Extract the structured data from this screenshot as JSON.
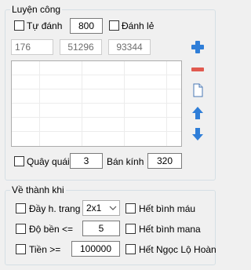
{
  "luyen_cong": {
    "title": "Luyện công",
    "tu_danh_label": "Tự đánh",
    "tu_danh_value": "800",
    "danh_le_label": "Đánh lẻ",
    "coords": [
      "176",
      "51296",
      "93344"
    ],
    "quay_quai_label": "Quây quái",
    "quay_quai_value": "3",
    "ban_kinh_label": "Bán kính",
    "ban_kinh_value": "320",
    "icons": {
      "add": "plus-icon",
      "remove": "minus-icon",
      "new": "document-icon",
      "up": "arrow-up-icon",
      "down": "arrow-down-icon"
    }
  },
  "ve_thanh_khi": {
    "title": "Về thành khi",
    "day_h_trang_label": "Đầy h. trang",
    "day_h_trang_value": "2x1",
    "do_ben_label": "Độ bền <=",
    "do_ben_value": "5",
    "tien_label": "Tiền >=",
    "tien_value": "100000",
    "het_binh_mau_label": "Hết bình máu",
    "het_binh_mana_label": "Hết bình mana",
    "het_ngoc_label": "Hết Ngọc Lộ Hoàn"
  },
  "colors": {
    "accent_blue": "#2f7ed8",
    "remove_red": "#e15a4f",
    "group_border": "#d5dfe5"
  }
}
